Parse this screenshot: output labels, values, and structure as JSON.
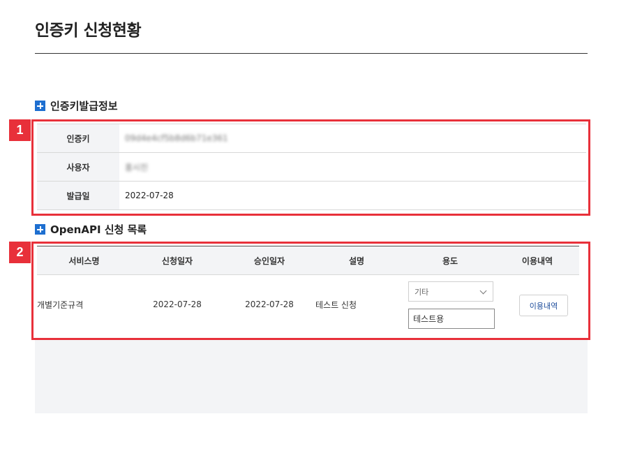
{
  "page": {
    "title": "인증키 신청현황"
  },
  "key_info": {
    "heading": "인증키발급정보",
    "rows": [
      {
        "label": "인증키",
        "value": "09d4e4cf5b8d6b71e361"
      },
      {
        "label": "사용자",
        "value": "홍시진"
      },
      {
        "label": "발급일",
        "value": "2022-07-28"
      }
    ]
  },
  "api_list": {
    "heading": "OpenAPI 신청 목록",
    "columns": [
      "서비스명",
      "신청일자",
      "승인일자",
      "설명",
      "용도",
      "이용내역"
    ],
    "row": {
      "service_name": "개별기준규격",
      "apply_date": "2022-07-28",
      "approve_date": "2022-07-28",
      "description": "테스트 신청",
      "usage_select": "기타",
      "usage_input": "테스트용",
      "history_button": "이용내역"
    }
  },
  "markers": [
    "1",
    "2"
  ],
  "colors": {
    "accent": "#1e6fd0",
    "highlight": "#e8303a",
    "header_bg": "#f3f4f6",
    "button_text": "#1f4e9c"
  }
}
